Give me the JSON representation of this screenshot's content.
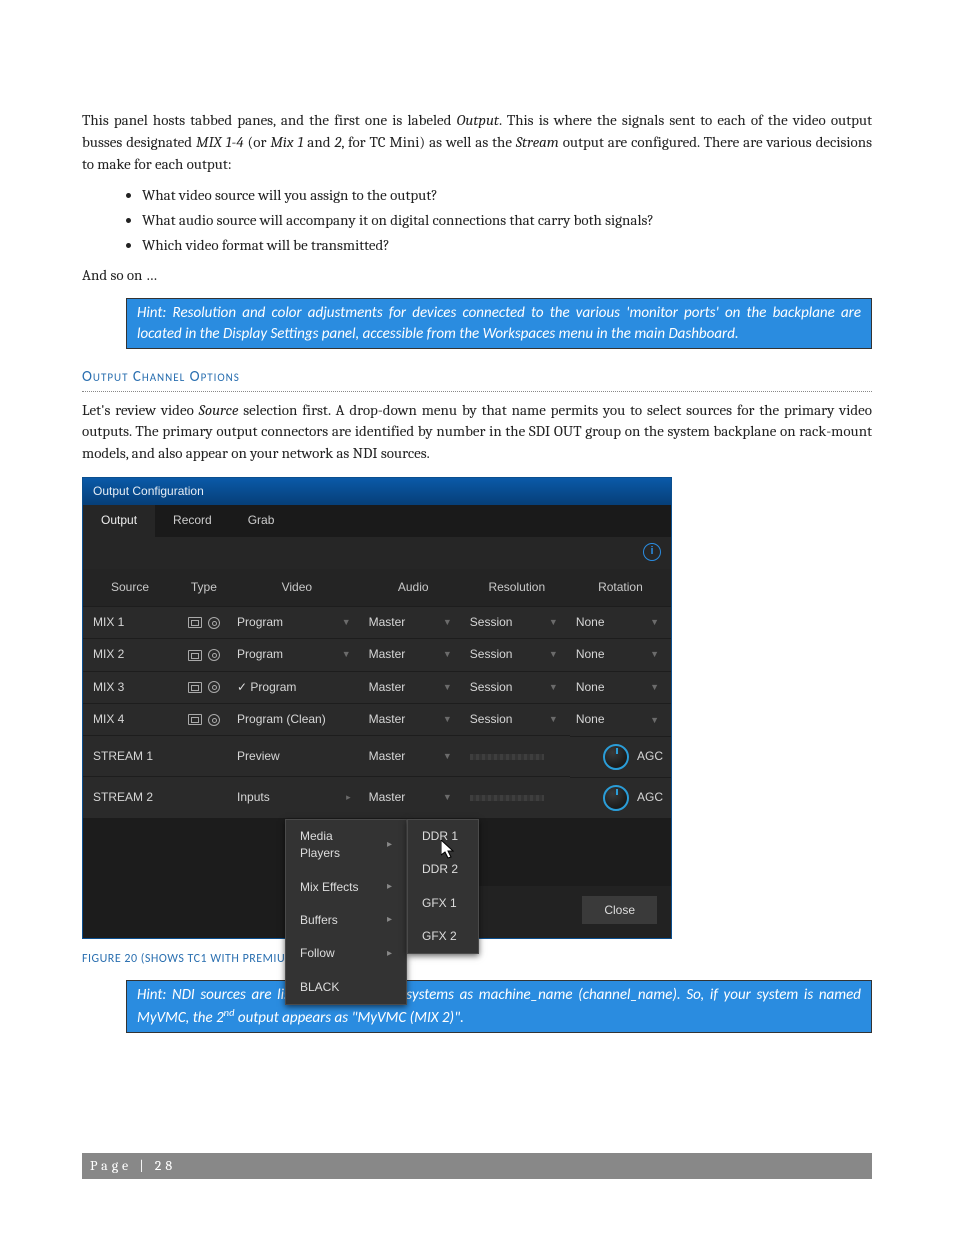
{
  "para1_a": "This panel hosts tabbed panes, and the first one is labeled ",
  "para1_i1": "Output",
  "para1_b": ".  This is where the signals sent to each of the video output busses designated ",
  "para1_i2": "MIX 1-4",
  "para1_c": " (or ",
  "para1_i3": "Mix 1",
  "para1_d": " and ",
  "para1_i4": "2",
  "para1_e": ", for TC Mini) as well as the ",
  "para1_i5": "Stream",
  "para1_f": " output are configured. There are various decisions to make for each output:",
  "bullets": [
    "What video source will you assign to the output?",
    "What audio source will accompany it on digital connections that carry both signals?",
    "Which video format will be transmitted?"
  ],
  "andsoon": "And so on …",
  "hint1": "Hint: Resolution and color adjustments for devices connected to the various 'monitor ports' on the backplane are located in the Display Settings panel, accessible from the Workspaces menu in the main Dashboard.",
  "section_head": "Output Channel Options",
  "para2_a": "Let's review video ",
  "para2_i1": "Source",
  "para2_b": " selection first. A drop-down menu by that name permits you to select sources for the primary video outputs. The primary output connectors are identified by number in the SDI OUT group on the system backplane on rack-mount models, and also appear on your network as NDI sources.",
  "ocfg": {
    "title": "Output Configuration",
    "tabs": [
      "Output",
      "Record",
      "Grab"
    ],
    "info_glyph": "i",
    "headers": [
      "Source",
      "Type",
      "Video",
      "Audio",
      "Resolution",
      "Rotation"
    ],
    "rows": [
      {
        "source": "MIX 1",
        "video": "Program",
        "audio": "Master",
        "res": "Session",
        "rot": "None",
        "type_icons": true,
        "video_dd": true,
        "audio_dd": true,
        "res_dd": true,
        "rot_dd": true
      },
      {
        "source": "MIX 2",
        "video": "Program",
        "audio": "Master",
        "res": "Session",
        "rot": "None",
        "type_icons": true,
        "video_dd": true,
        "audio_dd": true,
        "res_dd": true,
        "rot_dd": true
      },
      {
        "source": "MIX 3",
        "video": "Program",
        "audio": "Master",
        "res": "Session",
        "rot": "None",
        "type_icons": true,
        "video_check": true,
        "audio_dd": true,
        "res_dd": true,
        "rot_dd": true
      },
      {
        "source": "MIX 4",
        "video": "Program (Clean)",
        "audio": "Master",
        "res": "Session",
        "rot": "None",
        "type_icons": true,
        "audio_dd": true,
        "res_dd": true,
        "rot_dd": true
      },
      {
        "source": "STREAM 1",
        "video": "Preview",
        "audio": "Master",
        "agc": "AGC",
        "audio_dd": true
      },
      {
        "source": "STREAM 2",
        "video": "Inputs",
        "audio": "Master",
        "agc": "AGC",
        "video_sub": true,
        "audio_dd": true
      }
    ],
    "popup1": [
      "Media Players",
      "Mix Effects",
      "Buffers",
      "Follow",
      "BLACK"
    ],
    "popup1_sub": [
      true,
      true,
      true,
      true,
      false
    ],
    "popup2": [
      "DDR 1",
      "DDR 2",
      "GFX 1",
      "GFX 2"
    ],
    "close": "Close"
  },
  "caption": "FIGURE 20 (SHOWS TC1 WITH PREMIUM ACCESS FEATURES)",
  "hint2_a": "Hint:  NDI sources are listed by supporting systems as machine_name (channel_name). So, if your system is named MyVMC, the 2",
  "hint2_sup": "nd",
  "hint2_b": " output appears as \"MyVMC (MIX 2)\".",
  "footer": "Page | 28"
}
